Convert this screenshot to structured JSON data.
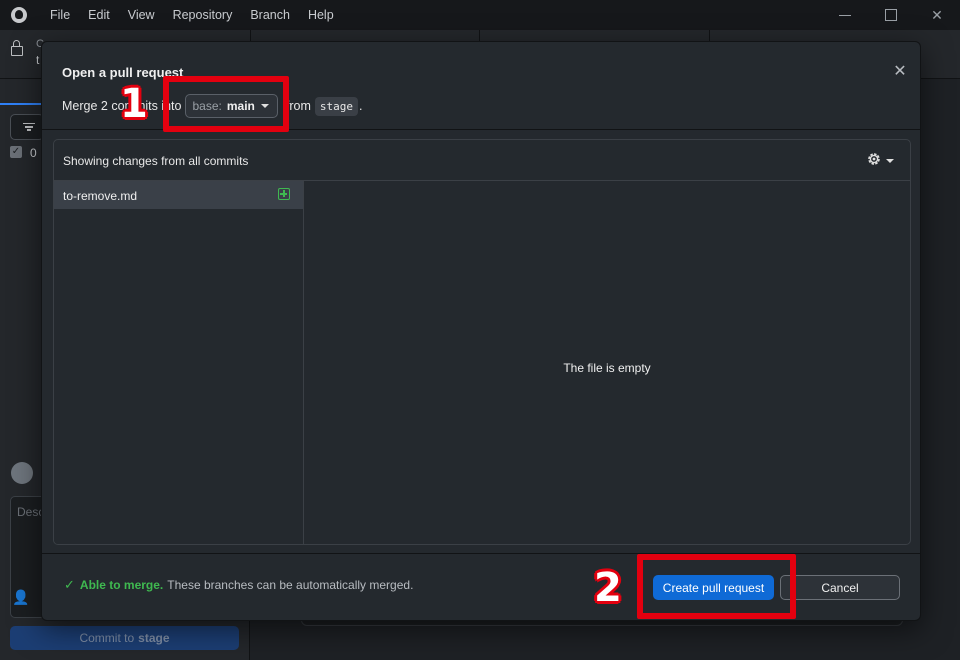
{
  "menu": [
    "File",
    "Edit",
    "View",
    "Repository",
    "Branch",
    "Help"
  ],
  "toolbar": {
    "repo_caption": "C",
    "repo_name": "t"
  },
  "left_pane": {
    "changes_count": "0",
    "description_placeholder": "Desc",
    "commit_button_prefix": "Commit to",
    "commit_button_branch": "stage"
  },
  "dialog": {
    "title": "Open a pull request",
    "merge_prefix": "Merge 2 commits into",
    "base_label": "base:",
    "base_branch": "main",
    "from_text": "from",
    "compare_branch": "stage",
    "period": ".",
    "changes_header": "Showing changes from all commits",
    "files": [
      {
        "name": "to-remove.md",
        "status": "added"
      }
    ],
    "empty_message": "The file is empty",
    "merge_status_label": "Able to merge.",
    "merge_status_detail": "These branches can be automatically merged.",
    "create_button": "Create pull request",
    "cancel_button": "Cancel"
  },
  "annotations": {
    "one": "1",
    "two": "2",
    "color": "#e3000f"
  },
  "colors": {
    "accent": "#0f6ad6",
    "success": "#3fb950",
    "dialog_bg": "#24292e"
  }
}
